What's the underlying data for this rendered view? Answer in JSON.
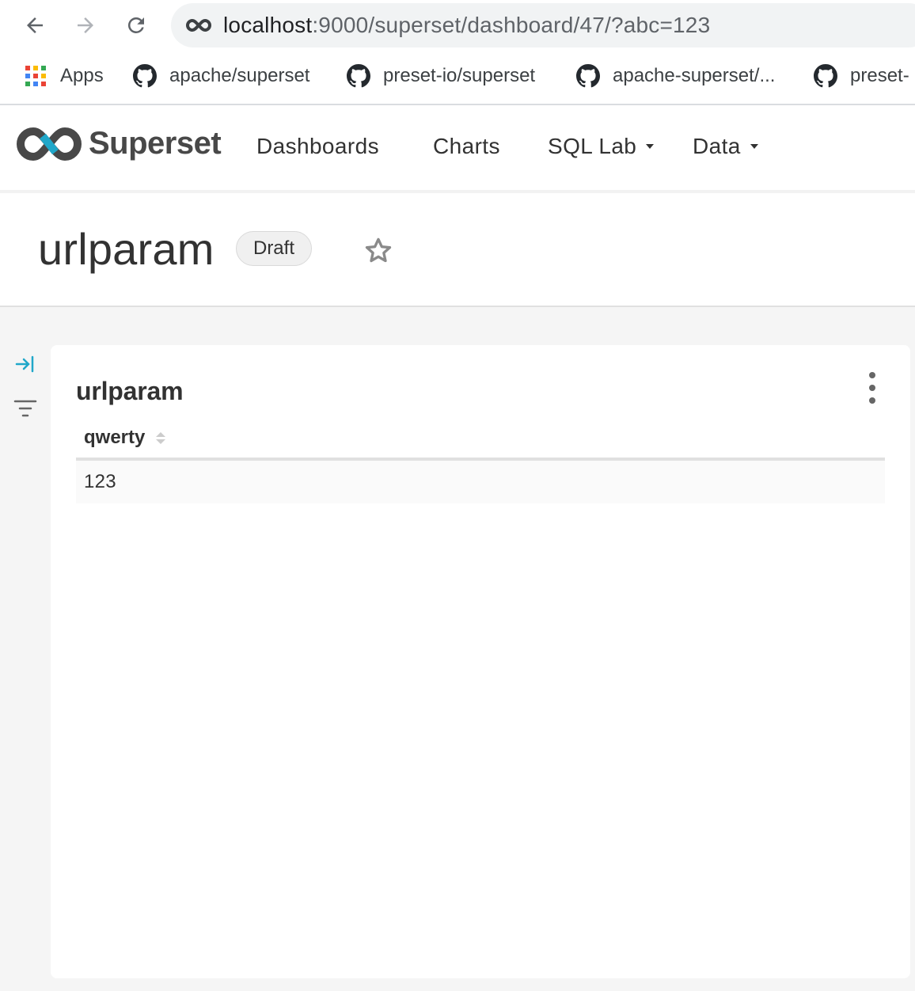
{
  "browser": {
    "url_host": "localhost",
    "url_rest": ":9000/superset/dashboard/47/?abc=123",
    "bookmarks": [
      {
        "label": "Apps",
        "icon": "apps-grid-icon"
      },
      {
        "label": "apache/superset",
        "icon": "github-icon"
      },
      {
        "label": "preset-io/superset",
        "icon": "github-icon"
      },
      {
        "label": "apache-superset/...",
        "icon": "github-icon"
      },
      {
        "label": "preset-",
        "icon": "github-icon"
      }
    ]
  },
  "app": {
    "brand": "Superset",
    "menu": [
      {
        "label": "Dashboards"
      },
      {
        "label": "Charts"
      },
      {
        "label": "SQL Lab",
        "dropdown": true
      },
      {
        "label": "Data",
        "dropdown": true
      }
    ]
  },
  "dashboard": {
    "title": "urlparam",
    "status": "Draft"
  },
  "chart": {
    "title": "urlparam",
    "columns": [
      "qwerty"
    ],
    "rows": [
      [
        "123"
      ]
    ]
  },
  "colors": {
    "accent": "#20a7c9",
    "logo_dark": "#484848",
    "body_bg": "#f5f5f5"
  }
}
